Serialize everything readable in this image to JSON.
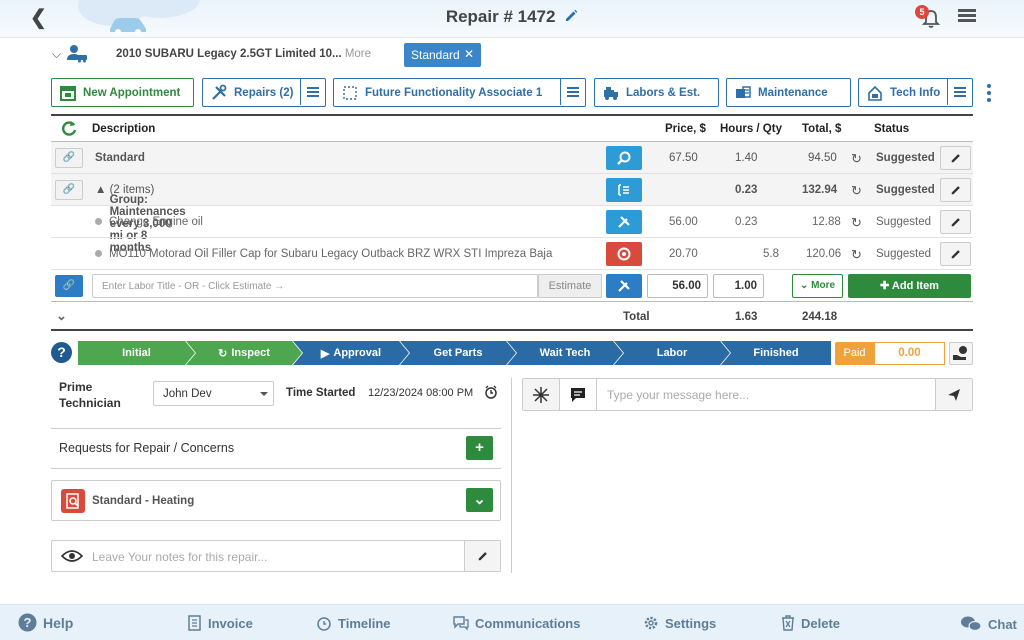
{
  "header": {
    "title": "Repair # 1472",
    "notification_count": "5"
  },
  "vehicle": {
    "name": "2010 SUBARU Legacy 2.5GT Limited 10...",
    "more_label": "More",
    "tag": "Standard"
  },
  "toolbar": {
    "new_appointment": "New Appointment",
    "repairs": "Repairs (2)",
    "future": "Future Functionality Associate 1",
    "labors": "Labors & Est.",
    "maintenance": "Maintenance",
    "tech_info": "Tech Info"
  },
  "table": {
    "headers": {
      "description": "Description",
      "price": "Price, $",
      "hours": "Hours / Qty",
      "total": "Total, $",
      "status": "Status"
    },
    "rows": [
      {
        "description": "Standard",
        "price": "67.50",
        "hours": "1.40",
        "total": "94.50",
        "status": "Suggested"
      },
      {
        "description": "Group: Maintenances every 3,000 mi or 8 months",
        "count": "(2 items)",
        "price": "",
        "hours": "0.23",
        "total": "132.94",
        "status": "Suggested"
      },
      {
        "description": "Change Engine oil",
        "price": "56.00",
        "hours": "0.23",
        "total": "12.88",
        "status": "Suggested"
      },
      {
        "description": "MO110 Motorad Oil Filler Cap for Subaru Legacy Outback BRZ WRX STI Impreza Baja",
        "price": "20.70",
        "hours": "5.8",
        "total": "120.06",
        "status": "Suggested"
      }
    ],
    "entry": {
      "placeholder": "Enter Labor Title - OR - Click Estimate →",
      "estimate": "Estimate",
      "price": "56.00",
      "qty": "1.00",
      "more": "More",
      "add_item": "Add Item"
    },
    "totals": {
      "label": "Total",
      "hours": "1.63",
      "total": "244.18"
    }
  },
  "workflow": {
    "steps": [
      "Initial",
      "Inspect",
      "Approval",
      "Get Parts",
      "Wait Tech",
      "Labor",
      "Finished"
    ],
    "paid_label": "Paid",
    "paid_value": "0.00"
  },
  "details": {
    "prime_technician_label": "Prime Technician",
    "technician": "John Dev",
    "time_started_label": "Time Started",
    "time_started": "12/23/2024 08:00 PM",
    "requests_label": "Requests for Repair / Concerns",
    "concern": "Standard - Heating",
    "notes_placeholder": "Leave Your notes for this repair..."
  },
  "chat": {
    "placeholder": "Type your message here..."
  },
  "nav": {
    "help": "Help",
    "invoice": "Invoice",
    "timeline": "Timeline",
    "communications": "Communications",
    "settings": "Settings",
    "delete": "Delete",
    "chat": "Chat"
  },
  "colors": {
    "primary": "#2e6fa8",
    "green": "#2e8b3d",
    "orange": "#f0a23a",
    "red": "#d84a3b",
    "cyan": "#2d9bd6"
  }
}
